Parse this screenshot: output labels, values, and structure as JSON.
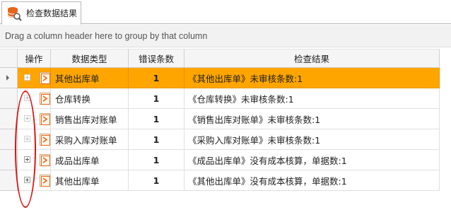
{
  "tab": {
    "label": "检查数据结果",
    "icon": "database-search-icon"
  },
  "group_panel": {
    "hint": "Drag a column header here to group by that column"
  },
  "columns": [
    {
      "label": "操作"
    },
    {
      "label": "数据类型"
    },
    {
      "label": "错误条数"
    },
    {
      "label": "检查结果"
    }
  ],
  "rows": [
    {
      "type": "其他出库单",
      "count": "1",
      "result": "《其他出库单》未审核条数:1",
      "selected": true
    },
    {
      "type": "仓库转换",
      "count": "1",
      "result": "《仓库转换》未审核条数:1",
      "selected": false
    },
    {
      "type": "销售出库对账单",
      "count": "1",
      "result": "《销售出库对账单》未审核条数:1",
      "selected": false
    },
    {
      "type": "采购入库对账单",
      "count": "1",
      "result": "《采购入库对账单》未审核条数:1",
      "selected": false
    },
    {
      "type": "成品出库单",
      "count": "1",
      "result": "《成品出库单》没有成本核算，单据数:1",
      "selected": false
    },
    {
      "type": "其他出库单",
      "count": "1",
      "result": "《其他出库单》没有成本核算，单据数:1",
      "selected": false
    }
  ],
  "colors": {
    "selected_row": "#ffa500",
    "error_count": "#a00000",
    "annotation": "#e01010"
  }
}
